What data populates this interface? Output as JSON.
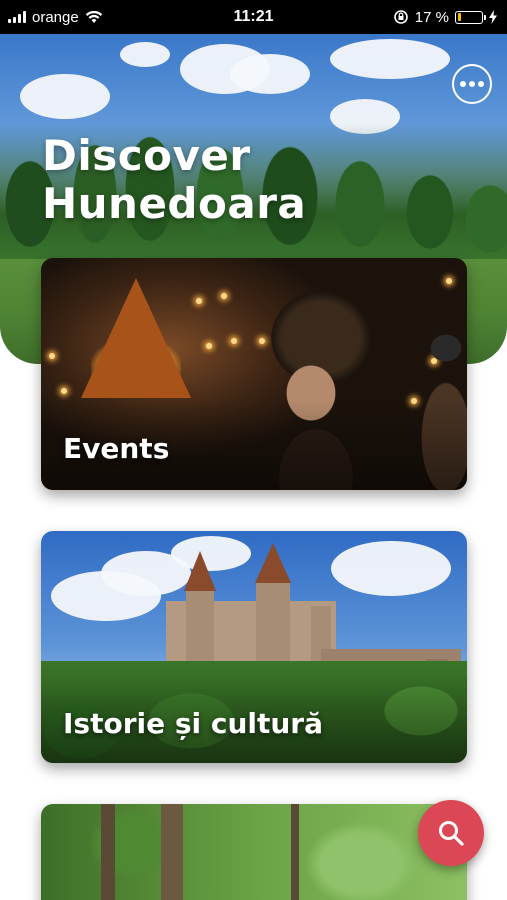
{
  "status_bar": {
    "carrier": "orange",
    "time": "11:21",
    "battery_percent": "17 %",
    "signal_bars": 4,
    "icons": [
      "signal-icon",
      "wifi-icon",
      "rotation-lock-icon",
      "battery-icon",
      "charging-icon"
    ]
  },
  "hero": {
    "title_line1": "Discover",
    "title_line2": "Hunedoara",
    "more_icon": "more-dots-icon"
  },
  "cards": [
    {
      "label": "Events"
    },
    {
      "label": "Istorie și cultură"
    },
    {
      "label": ""
    }
  ],
  "fab": {
    "icon": "search-icon",
    "color": "#dc4755"
  },
  "colors": {
    "accent": "#dc4755",
    "battery_level": "#f2c200"
  }
}
